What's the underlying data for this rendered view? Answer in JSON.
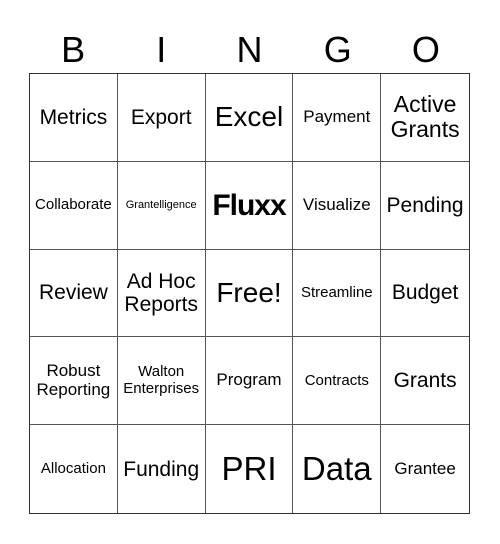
{
  "header": {
    "letters": [
      "B",
      "I",
      "N",
      "G",
      "O"
    ]
  },
  "cells": [
    {
      "text": "Metrics",
      "size": "m"
    },
    {
      "text": "Export",
      "size": "m"
    },
    {
      "text": "Excel",
      "size": "l"
    },
    {
      "text": "Payment",
      "size": "sm"
    },
    {
      "text": "Active Grants",
      "size": "m"
    },
    {
      "text": "Collaborate",
      "size": "xs"
    },
    {
      "text": "Grantelligence",
      "size": "xxs"
    },
    {
      "text": "Fluxx",
      "size": "logo"
    },
    {
      "text": "Visualize",
      "size": "sm"
    },
    {
      "text": "Pending",
      "size": "m"
    },
    {
      "text": "Review",
      "size": "m"
    },
    {
      "text": "Ad Hoc Reports",
      "size": "m"
    },
    {
      "text": "Free!",
      "size": "l"
    },
    {
      "text": "Streamline",
      "size": "s"
    },
    {
      "text": "Budget",
      "size": "m"
    },
    {
      "text": "Robust Reporting",
      "size": "sm"
    },
    {
      "text": "Walton Enterprises",
      "size": "s"
    },
    {
      "text": "Program",
      "size": "sm"
    },
    {
      "text": "Contracts",
      "size": "s"
    },
    {
      "text": "Grants",
      "size": "m"
    },
    {
      "text": "Allocation",
      "size": "s"
    },
    {
      "text": "Funding",
      "size": "m"
    },
    {
      "text": "PRI",
      "size": "xl"
    },
    {
      "text": "Data",
      "size": "xl"
    },
    {
      "text": "Grantee",
      "size": "sm"
    }
  ]
}
